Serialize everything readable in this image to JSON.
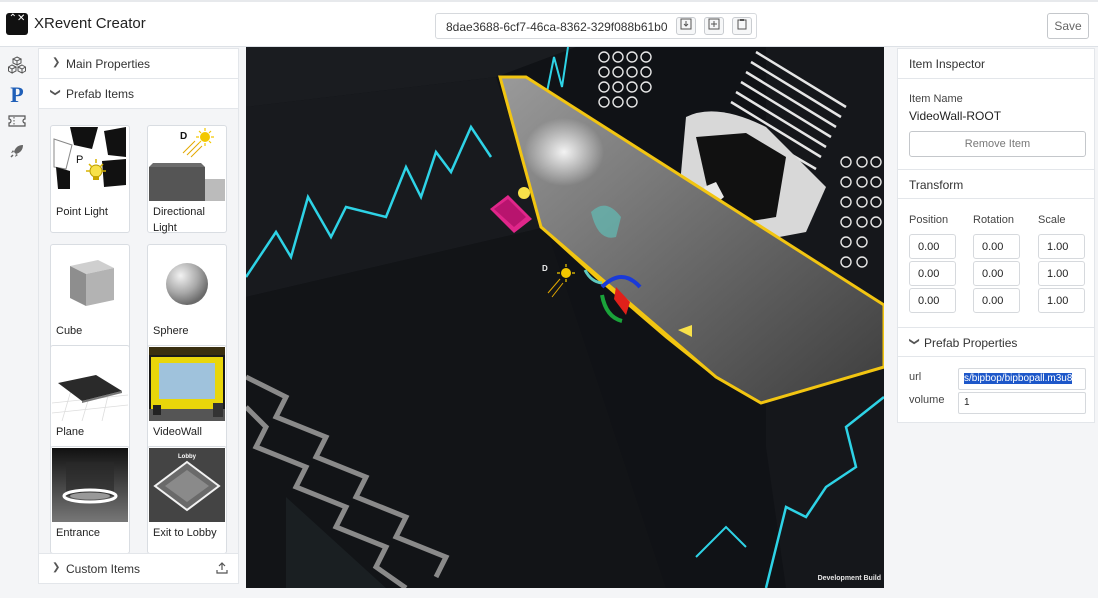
{
  "app": {
    "title": "XRevent Creator",
    "logo_glyph": "⌃✕"
  },
  "header": {
    "item_id": "8dae3688-6cf7-46ca-8362-329f088b61b0",
    "save_label": "Save",
    "icons": [
      "download-icon",
      "add-icon",
      "clipboard-icon"
    ]
  },
  "rail": {
    "p_label": "P",
    "icons": [
      "cubes-icon",
      "prefab-icon",
      "ticket-icon",
      "rocket-icon"
    ]
  },
  "left_panel": {
    "main_properties": "Main Properties",
    "prefab_items": "Prefab Items",
    "custom_items": "Custom Items",
    "prefabs": [
      {
        "name": "Point Light"
      },
      {
        "name": "Directional Light"
      },
      {
        "name": "Cube"
      },
      {
        "name": "Sphere"
      },
      {
        "name": "Plane"
      },
      {
        "name": "VideoWall"
      },
      {
        "name": "Entrance"
      },
      {
        "name": "Exit to Lobby"
      }
    ],
    "thumb_letters": {
      "p": "P",
      "d": "D",
      "lobby": "Lobby"
    }
  },
  "viewport": {
    "dev_build": "Development Build",
    "gizmo_d": "D"
  },
  "inspector": {
    "title": "Item Inspector",
    "item_name_label": "Item Name",
    "item_name": "VideoWall-ROOT",
    "remove_label": "Remove Item",
    "transform_title": "Transform",
    "col_position": "Position",
    "col_rotation": "Rotation",
    "col_scale": "Scale",
    "position": [
      "0.00",
      "0.00",
      "0.00"
    ],
    "rotation": [
      "0.00",
      "0.00",
      "0.00"
    ],
    "scale": [
      "1.00",
      "1.00",
      "1.00"
    ],
    "prefab_props_title": "Prefab Properties",
    "url_label": "url",
    "url_value": "s/bipbop/bipbopall.m3u8",
    "volume_label": "volume",
    "volume_value": "1"
  },
  "colors": {
    "accent": "#1f5fb8",
    "selection": "#1d57c9",
    "outline": "#f2c511",
    "neon": "#2ed3e6"
  }
}
